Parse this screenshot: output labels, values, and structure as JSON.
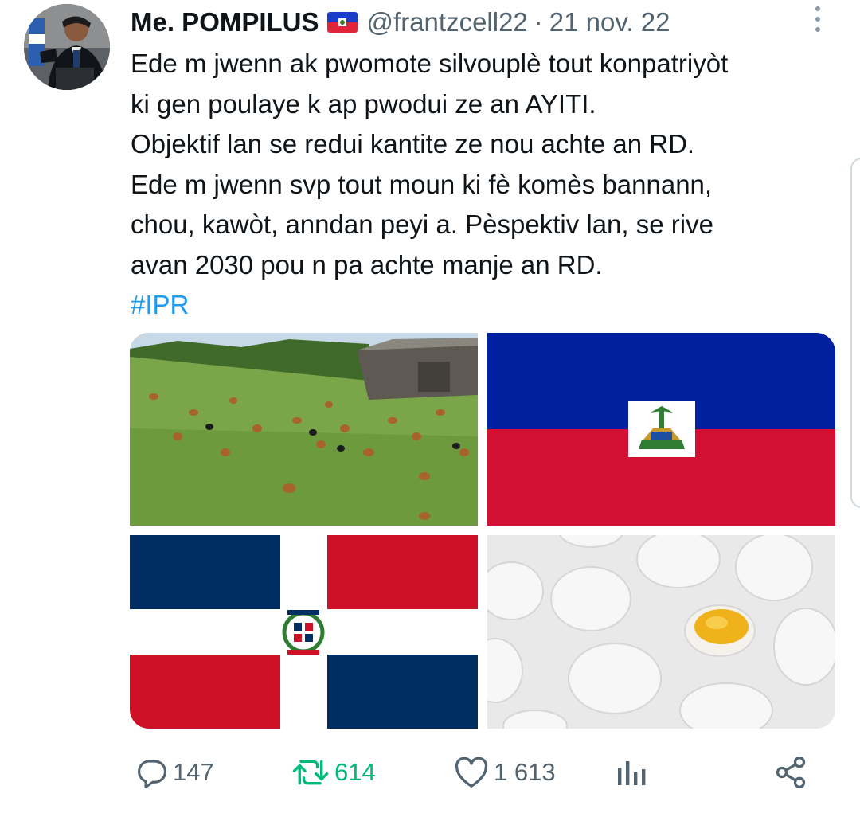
{
  "tweet": {
    "author_name": "Me. POMPILUS",
    "handle": "@frantzcell22",
    "separator": "·",
    "date": "21 nov. 22",
    "lines": [
      "Ede m jwenn ak pwomote silvouplè tout konpatriyòt",
      "ki gen poulaye k ap pwodui ze an AYITI.",
      "Objektif lan se redui kantite ze nou achte an RD.",
      "Ede m jwenn svp tout moun ki fè komès bannann,",
      "chou, kawòt, anndan peyi a. Pèspektiv lan, se rive",
      "avan 2030 pou n pa achte manje an RD."
    ],
    "hashtag": "#IPR"
  },
  "media": [
    {
      "name": "chicken-farm-photo"
    },
    {
      "name": "haiti-flag-image"
    },
    {
      "name": "dominican-republic-flag-image"
    },
    {
      "name": "eggs-photo"
    }
  ],
  "actions": {
    "reply_count": "147",
    "retweet_count": "614",
    "like_count": "1 613"
  },
  "colors": {
    "text": "#0f1419",
    "secondary": "#536471",
    "link": "#1d9bf0",
    "retweet": "#00ba7c",
    "haiti_blue": "#00209f",
    "haiti_red": "#d21034",
    "dr_blue": "#002d62",
    "dr_red": "#ce1126"
  },
  "icons": [
    "reply-icon",
    "retweet-icon",
    "like-icon",
    "views-icon",
    "share-icon",
    "more-icon"
  ]
}
